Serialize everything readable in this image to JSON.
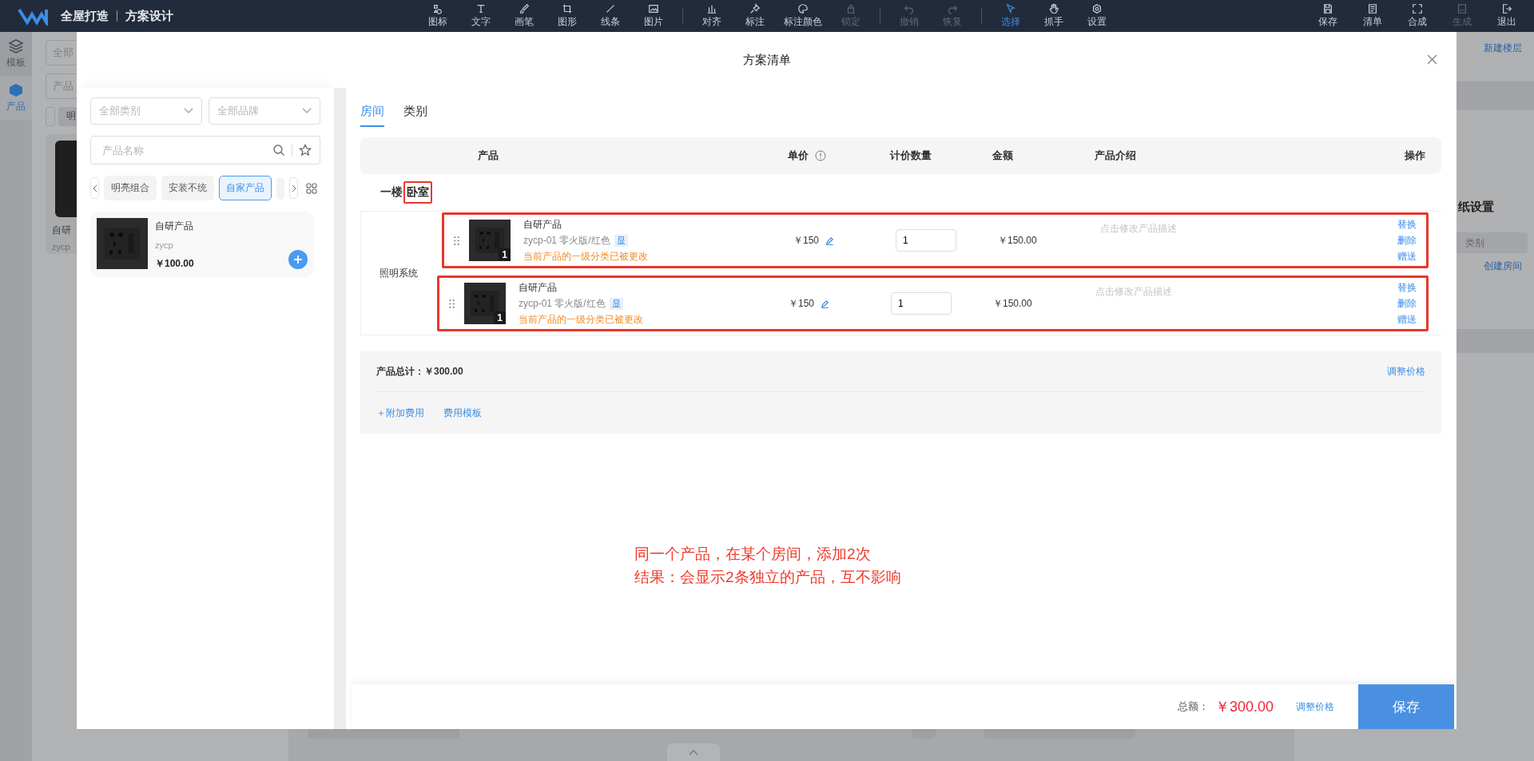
{
  "top_bar": {
    "brand": "全屋打造",
    "module": "方案设计",
    "tool_groups": [
      {
        "items": [
          {
            "label": "图标",
            "disabled": false,
            "selected": false
          },
          {
            "label": "文字",
            "disabled": false,
            "selected": false
          },
          {
            "label": "画笔",
            "disabled": false,
            "selected": false
          },
          {
            "label": "图形",
            "disabled": false,
            "selected": false
          },
          {
            "label": "线条",
            "disabled": false,
            "selected": false
          },
          {
            "label": "图片",
            "disabled": false,
            "selected": false
          }
        ]
      },
      {
        "items": [
          {
            "label": "对齐",
            "disabled": false,
            "selected": false
          },
          {
            "label": "标注",
            "disabled": false,
            "selected": false
          },
          {
            "label": "标注颜色",
            "disabled": false,
            "selected": false
          },
          {
            "label": "锁定",
            "disabled": true,
            "selected": false
          }
        ]
      },
      {
        "items": [
          {
            "label": "撤销",
            "disabled": true,
            "selected": false
          },
          {
            "label": "恢复",
            "disabled": true,
            "selected": false
          }
        ]
      },
      {
        "items": [
          {
            "label": "选择",
            "disabled": false,
            "selected": true
          },
          {
            "label": "抓手",
            "disabled": false,
            "selected": false
          },
          {
            "label": "设置",
            "disabled": false,
            "selected": false
          }
        ]
      }
    ],
    "actions": [
      {
        "label": "保存",
        "disabled": false
      },
      {
        "label": "清单",
        "disabled": false
      },
      {
        "label": "合成",
        "disabled": false
      },
      {
        "label": "生成",
        "disabled": true
      },
      {
        "label": "退出",
        "disabled": false
      }
    ]
  },
  "side_rail": [
    {
      "label": "模板",
      "selected": false
    },
    {
      "label": "产品",
      "selected": true
    }
  ],
  "background_left": {
    "category_field": "全部",
    "search_field": "产品",
    "chip": "明",
    "product_name": "自研",
    "product_code": "zycp"
  },
  "background_right": {
    "new_floor": "新建楼层",
    "section_title": "纸设置",
    "category_field": "类别",
    "create_room": "创建房间"
  },
  "dialog": {
    "title": "方案清单",
    "picker": {
      "category_select": {
        "placeholder": "全部类别"
      },
      "brand_select": {
        "placeholder": "全部品牌"
      },
      "search": {
        "placeholder": "产品名称"
      },
      "chips": [
        {
          "label": "明亮组合",
          "selected": false
        },
        {
          "label": "安装不统",
          "selected": false
        },
        {
          "label": "自家产品",
          "selected": true
        }
      ],
      "products": [
        {
          "name": "自研产品",
          "code": "zycp",
          "price": "￥100.00"
        }
      ]
    },
    "tabs": [
      {
        "label": "房间",
        "selected": true
      },
      {
        "label": "类别",
        "selected": false
      }
    ],
    "table": {
      "columns": [
        "产品",
        "单价",
        "计价数量",
        "金额",
        "产品介绍",
        "操作"
      ],
      "rooms": [
        {
          "floor": "一楼",
          "room": "卧室",
          "highlighted": true,
          "groups": [
            {
              "name": "照明系统",
              "items": [
                {
                  "name": "自研产品",
                  "spec": "zycp-01 零火版/红色",
                  "tag": "显",
                  "warning": "当前产品的一级分类已被更改",
                  "count_badge": "1",
                  "price": "￥150",
                  "quantity": "1",
                  "amount": "￥150.00",
                  "description_placeholder": "点击修改产品描述",
                  "actions": [
                    "替换",
                    "删除",
                    "赠送"
                  ],
                  "highlighted": true
                },
                {
                  "name": "自研产品",
                  "spec": "zycp-01 零火版/红色",
                  "tag": "显",
                  "warning": "当前产品的一级分类已被更改",
                  "count_badge": "1",
                  "price": "￥150",
                  "quantity": "1",
                  "amount": "￥150.00",
                  "description_placeholder": "点击修改产品描述",
                  "actions": [
                    "替换",
                    "删除",
                    "赠送"
                  ],
                  "highlighted": true
                }
              ]
            }
          ]
        }
      ]
    },
    "summary": {
      "total": "产品总计：￥300.00",
      "adjust_link": "调整价格",
      "extra_links": [
        "＋附加费用",
        "费用模板"
      ]
    },
    "footer": {
      "total_label": "总额：",
      "total_value": "￥300.00",
      "adjust_link": "调整价格",
      "save_button": "保存"
    }
  },
  "annotation": {
    "lines": [
      "同一个产品，在某个房间，添加2次",
      "结果：会显示2条独立的产品，互不影响"
    ]
  }
}
